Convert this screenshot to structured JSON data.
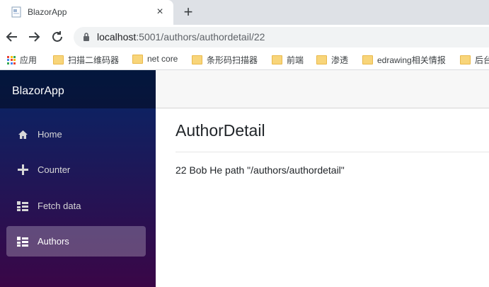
{
  "browser": {
    "tab": {
      "title": "BlazorApp",
      "close_icon": "×",
      "new_tab_icon": "+"
    },
    "url": {
      "host": "localhost",
      "rest": ":5001/authors/authordetail/22"
    },
    "bookmarks": [
      {
        "label": "应用",
        "icon": "apps-icon"
      },
      {
        "label": "扫描二维码器",
        "icon": "folder-icon"
      },
      {
        "label": "net core",
        "icon": "folder-icon"
      },
      {
        "label": "条形码扫描器",
        "icon": "folder-icon"
      },
      {
        "label": "前端",
        "icon": "folder-icon"
      },
      {
        "label": "渗透",
        "icon": "folder-icon"
      },
      {
        "label": "edrawing相关情报",
        "icon": "folder-icon"
      },
      {
        "label": "后台",
        "icon": "folder-icon"
      }
    ]
  },
  "app": {
    "brand": "BlazorApp",
    "nav": [
      {
        "label": "Home",
        "icon": "home-icon"
      },
      {
        "label": "Counter",
        "icon": "plus-icon"
      },
      {
        "label": "Fetch data",
        "icon": "list-icon"
      },
      {
        "label": "Authors",
        "icon": "list-icon",
        "active": true
      }
    ],
    "page_title": "AuthorDetail",
    "detail_text": "22 Bob He path \"/authors/authordetail\""
  },
  "colors": {
    "sidebar_top": "#052767",
    "sidebar_bottom": "#3a0647",
    "folder": "#f8d57a"
  }
}
